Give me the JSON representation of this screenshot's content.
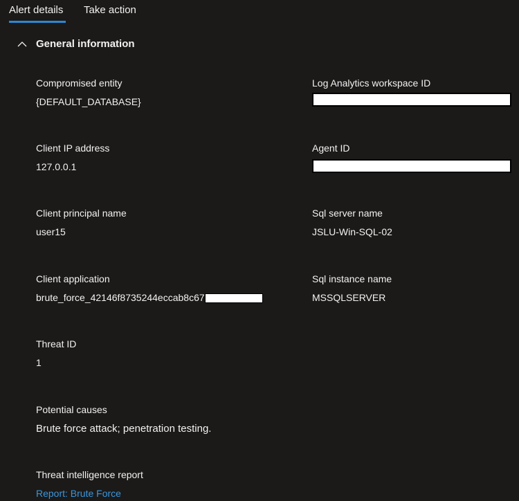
{
  "tabs": [
    {
      "label": "Alert details",
      "active": true
    },
    {
      "label": "Take action",
      "active": false
    }
  ],
  "section": {
    "title": "General information",
    "icon": "chevron-up-icon"
  },
  "left_fields": [
    {
      "label": "Compromised entity",
      "value": "{DEFAULT_DATABASE}"
    },
    {
      "label": "Client IP address",
      "value": "127.0.0.1"
    },
    {
      "label": "Client principal name",
      "value": "user15"
    },
    {
      "label": "Client application",
      "value": "brute_force_42146f8735244eccab8c67"
    },
    {
      "label": "Threat ID",
      "value": "1"
    },
    {
      "label": "Potential causes",
      "value": "Brute force attack; penetration testing."
    },
    {
      "label": "Threat intelligence report",
      "value": "Report: Brute Force"
    }
  ],
  "right_fields": [
    {
      "label": "Log Analytics workspace ID",
      "value": ""
    },
    {
      "label": "Agent ID",
      "value": ""
    },
    {
      "label": "Sql server name",
      "value": "JSLU-Win-SQL-02"
    },
    {
      "label": "Sql instance name",
      "value": "MSSQLSERVER"
    }
  ],
  "colors": {
    "background": "#1b1a19",
    "accent": "#2b88d8",
    "link": "#3a96dd"
  }
}
